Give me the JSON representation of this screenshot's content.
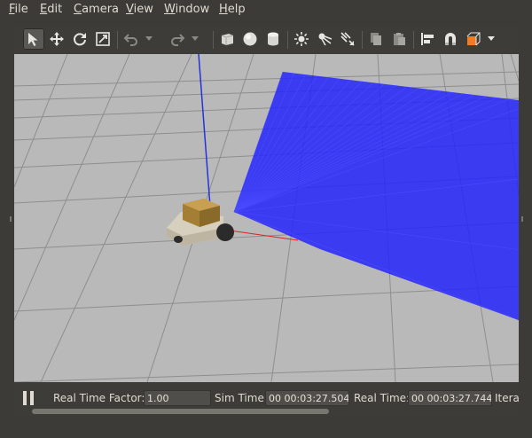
{
  "menu": [
    {
      "label": "File",
      "mnemonic": "F",
      "rest": "ile"
    },
    {
      "label": "Edit",
      "mnemonic": "E",
      "rest": "dit"
    },
    {
      "label": "Camera",
      "mnemonic": "C",
      "rest": "amera"
    },
    {
      "label": "View",
      "mnemonic": "V",
      "rest": "iew"
    },
    {
      "label": "Window",
      "mnemonic": "W",
      "rest": "indow"
    },
    {
      "label": "Help",
      "mnemonic": "H",
      "rest": "elp"
    }
  ],
  "toolbar": {
    "tools": [
      "select-arrow-icon",
      "translate-icon",
      "rotate-icon",
      "scale-icon",
      "undo-icon",
      "redo-icon",
      "box-icon",
      "sphere-icon",
      "cylinder-icon",
      "point-light-icon",
      "spot-light-icon",
      "directional-light-icon",
      "copy-icon",
      "paste-icon",
      "align-icon",
      "magnet-icon",
      "view-angle-icon"
    ],
    "active_tool": "select-arrow-icon",
    "accent_color": "#f07c23"
  },
  "scene": {
    "ground_color": "#b9b9b9",
    "grid_color": "#8e8e8e",
    "laser_color": "#2020ff",
    "z_axis_color": "#2233dd",
    "x_axis_color": "#dd2222"
  },
  "status": {
    "real_time_factor_label": "Real Time Factor:",
    "real_time_factor_value": "1.00",
    "sim_time_label": "Sim Time:",
    "sim_time_value": "00 00:03:27.504",
    "real_time_label": "Real Time:",
    "real_time_value": "00 00:03:27.744",
    "iterations_label": "Itera"
  }
}
